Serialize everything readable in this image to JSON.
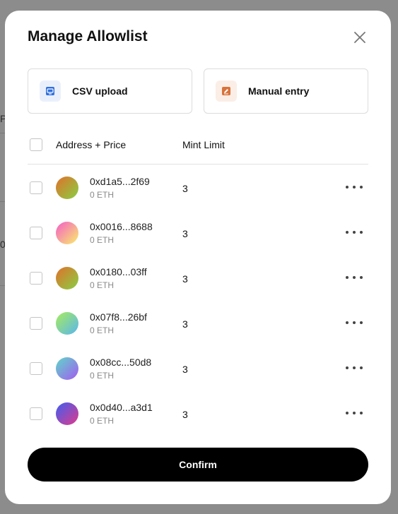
{
  "background": {
    "fragments": [
      "Pr",
      "0"
    ]
  },
  "modal": {
    "title": "Manage Allowlist",
    "options": [
      {
        "label": "CSV upload",
        "icon": "csv-upload-icon",
        "accent": "#2f6fe0"
      },
      {
        "label": "Manual entry",
        "icon": "edit-icon",
        "accent": "#d9733a"
      }
    ],
    "table": {
      "headers": {
        "address": "Address + Price",
        "limit": "Mint Limit"
      },
      "rows": [
        {
          "address": "0xd1a5...2f69",
          "price": "0 ETH",
          "limit": "3",
          "gradient": [
            "#e0702a",
            "#88d043"
          ]
        },
        {
          "address": "0x0016...8688",
          "price": "0 ETH",
          "limit": "3",
          "gradient": [
            "#f45cc8",
            "#f9ef6a"
          ]
        },
        {
          "address": "0x0180...03ff",
          "price": "0 ETH",
          "limit": "3",
          "gradient": [
            "#e0702a",
            "#88d043"
          ]
        },
        {
          "address": "0x07f8...26bf",
          "price": "0 ETH",
          "limit": "3",
          "gradient": [
            "#a8ec5a",
            "#58b6f0"
          ]
        },
        {
          "address": "0x08cc...50d8",
          "price": "0 ETH",
          "limit": "3",
          "gradient": [
            "#5fd8c8",
            "#a35af0"
          ]
        },
        {
          "address": "0x0d40...a3d1",
          "price": "0 ETH",
          "limit": "3",
          "gradient": [
            "#3f5ef0",
            "#e03a8c"
          ]
        }
      ]
    },
    "confirm_label": "Confirm"
  }
}
